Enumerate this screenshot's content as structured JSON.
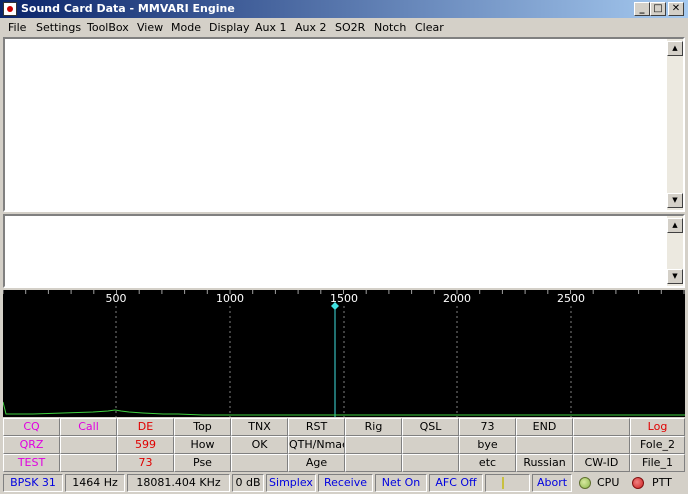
{
  "window": {
    "title": "Sound Card Data - MMVARI Engine",
    "min": "_",
    "max": "□",
    "close": "✕"
  },
  "menu": [
    "File",
    "Settings",
    "ToolBox",
    "View",
    "Mode",
    "Display",
    "Aux 1",
    "Aux 2",
    "SO2R",
    "Notch",
    "Clear"
  ],
  "spectrum": {
    "ticks": [
      "500",
      "1000",
      "1500",
      "2000",
      "2500"
    ],
    "marker_hz": 1464
  },
  "macros": [
    [
      {
        "label": "CQ",
        "color": "#e000e0"
      },
      {
        "label": "Call",
        "color": "#e000e0"
      },
      {
        "label": "DE",
        "color": "#e00000"
      },
      {
        "label": "Top",
        "color": "#000000"
      },
      {
        "label": "TNX",
        "color": "#000000"
      },
      {
        "label": "RST",
        "color": "#000000"
      },
      {
        "label": "Rig",
        "color": "#000000"
      },
      {
        "label": "QSL",
        "color": "#000000"
      },
      {
        "label": "73",
        "color": "#000000"
      },
      {
        "label": "END",
        "color": "#000000"
      },
      {
        "label": "",
        "color": "#000000"
      },
      {
        "label": "Log",
        "color": "#e00000"
      }
    ],
    [
      {
        "label": "QRZ",
        "color": "#e000e0"
      },
      {
        "label": "",
        "color": "#000000"
      },
      {
        "label": "599",
        "color": "#e00000"
      },
      {
        "label": "How",
        "color": "#000000"
      },
      {
        "label": "OK",
        "color": "#000000"
      },
      {
        "label": "QTH/Nmae",
        "color": "#000000"
      },
      {
        "label": "",
        "color": "#000000"
      },
      {
        "label": "",
        "color": "#000000"
      },
      {
        "label": "bye",
        "color": "#000000"
      },
      {
        "label": "",
        "color": "#000000"
      },
      {
        "label": "",
        "color": "#000000"
      },
      {
        "label": "Fole_2",
        "color": "#000000"
      }
    ],
    [
      {
        "label": "TEST",
        "color": "#e000e0"
      },
      {
        "label": "",
        "color": "#000000"
      },
      {
        "label": "73",
        "color": "#e00000"
      },
      {
        "label": "Pse",
        "color": "#000000"
      },
      {
        "label": "",
        "color": "#000000"
      },
      {
        "label": "Age",
        "color": "#000000"
      },
      {
        "label": "",
        "color": "#000000"
      },
      {
        "label": "",
        "color": "#000000"
      },
      {
        "label": "etc",
        "color": "#000000"
      },
      {
        "label": "Russian",
        "color": "#000000"
      },
      {
        "label": "CW-ID",
        "color": "#000000"
      },
      {
        "label": "File_1",
        "color": "#000000"
      }
    ]
  ],
  "status": {
    "mode": "BPSK 31",
    "audio_freq": "1464 Hz",
    "rf_freq": "18081.404 KHz",
    "level": "0 dB",
    "simplex": "Simplex",
    "receive": "Receive",
    "net": "Net On",
    "afc": "AFC Off",
    "abort": "Abort",
    "cpu": "CPU",
    "ptt": "PTT"
  },
  "colors": {
    "accent_blue": "#0000e0",
    "status_green": "#8ab84a",
    "status_red": "#cc2020",
    "spectrum_line": "#40d040",
    "marker": "#40e0e0"
  }
}
